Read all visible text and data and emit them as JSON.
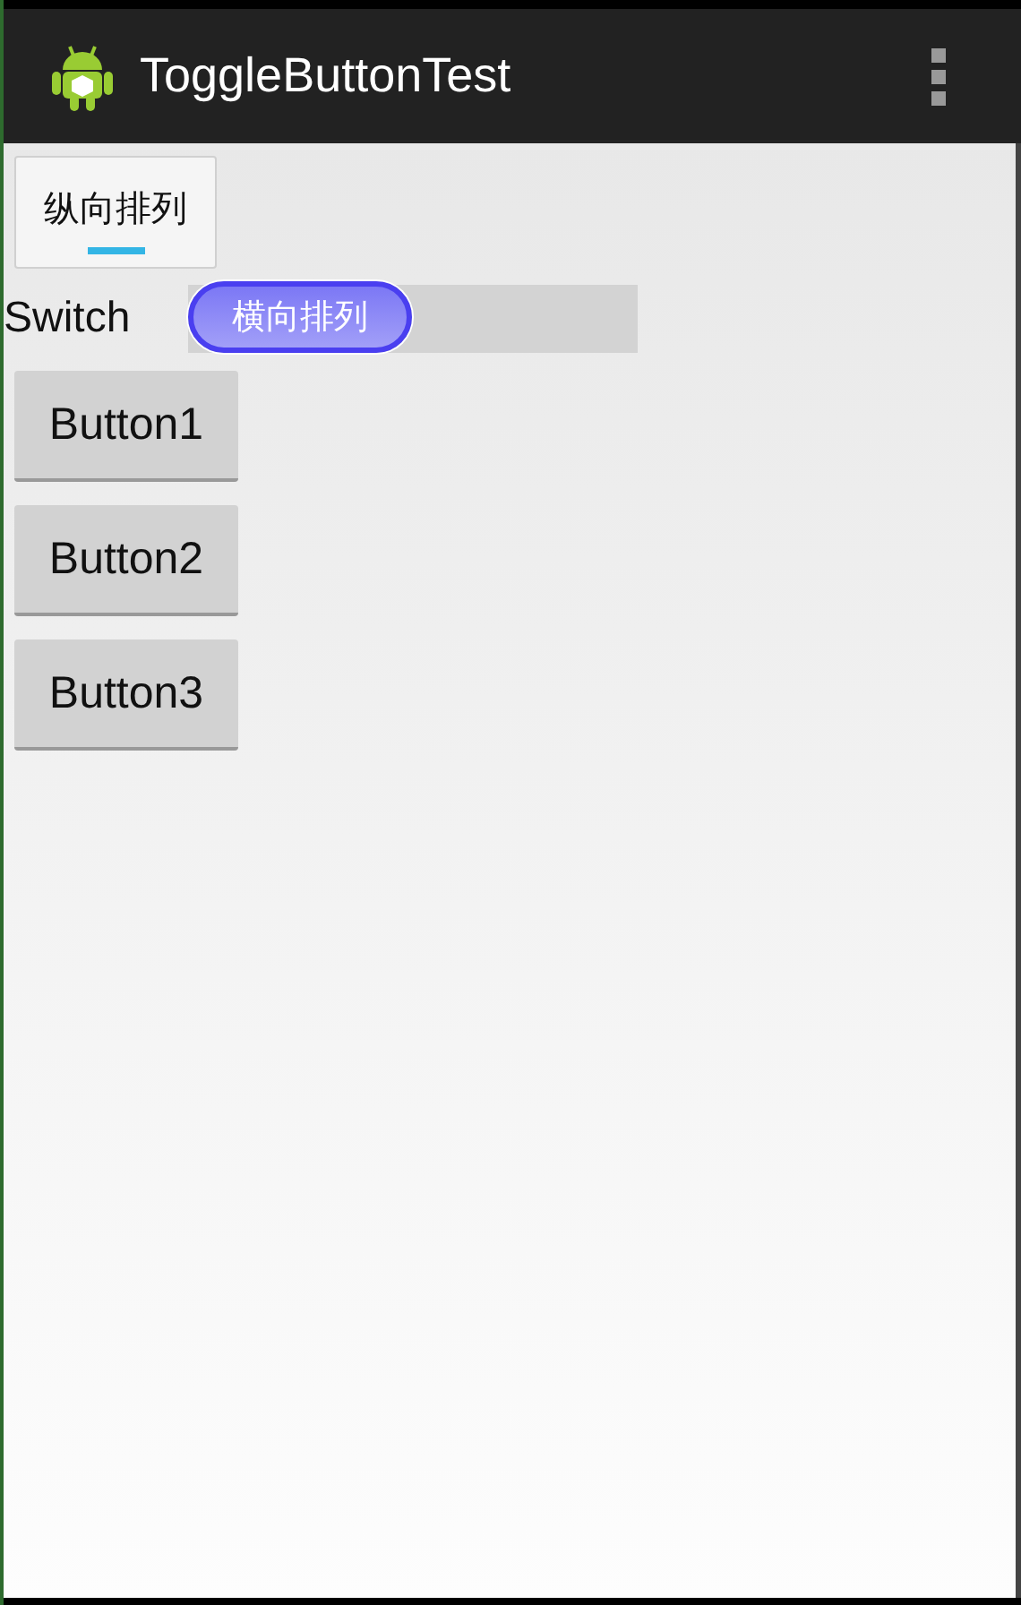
{
  "action_bar": {
    "title": "ToggleButtonTest"
  },
  "toggle_button": {
    "label": "纵向排列",
    "checked": true
  },
  "switch": {
    "label": "Switch",
    "thumb_text": "横向排列",
    "on": false
  },
  "buttons": [
    {
      "label": "Button1"
    },
    {
      "label": "Button2"
    },
    {
      "label": "Button3"
    }
  ]
}
